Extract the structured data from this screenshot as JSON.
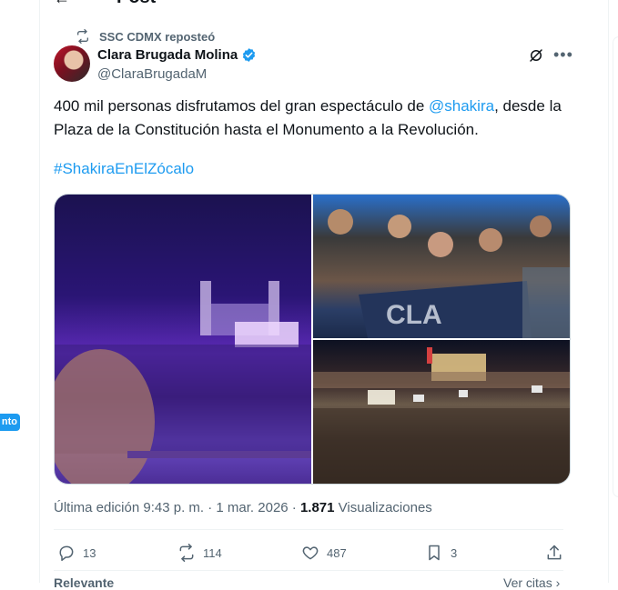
{
  "header": {
    "title": "Post",
    "back_icon": "back-arrow-icon"
  },
  "repost": {
    "label": "SSC CDMX reposteó",
    "icon": "repost-icon"
  },
  "author": {
    "name": "Clara Brugada Molina",
    "handle": "@ClaraBrugadaM",
    "verified": true
  },
  "post": {
    "text_before": "400 mil personas disfrutamos del gran espectáculo de ",
    "mention": "@shakira",
    "text_after": ", desde la Plaza de la Constitución hasta el Monumento a la Revolución.",
    "hashtag": "#ShakiraEnElZócalo"
  },
  "meta": {
    "edited": "Última edición 9:43 p. m. · 1 mar. 2026 · ",
    "views_count": "1.871",
    "views_label": " Visualizaciones"
  },
  "actions": {
    "replies": "13",
    "reposts": "114",
    "likes": "487",
    "bookmarks": "3"
  },
  "footer": {
    "left": "Relevante",
    "right": "Ver citas ›"
  },
  "left_badge": "nto",
  "colors": {
    "accent": "#1d9bf0",
    "muted": "#536471",
    "text": "#0f1419"
  }
}
